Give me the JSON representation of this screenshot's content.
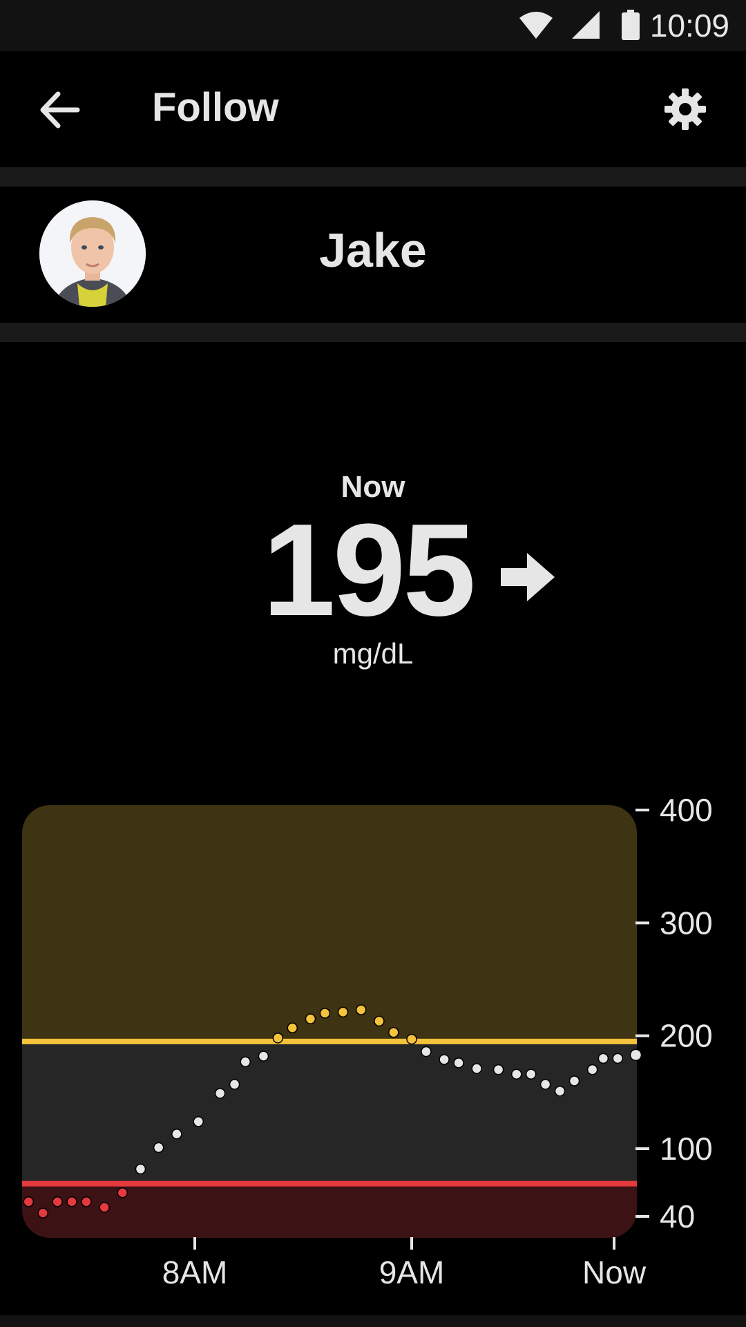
{
  "status_bar": {
    "time": "10:09",
    "icons": [
      "wifi-icon",
      "signal-icon",
      "battery-icon"
    ]
  },
  "app_bar": {
    "title": "Follow",
    "back_icon": "arrow-left-icon",
    "settings_icon": "gear-icon"
  },
  "profile": {
    "name": "Jake"
  },
  "reading": {
    "label": "Now",
    "value": "195",
    "unit": "mg/dL",
    "trend_icon": "arrow-right-icon"
  },
  "colors": {
    "background": "#000000",
    "high_zone": "#3e3312",
    "in_range_zone": "#262626",
    "low_zone": "#3c1214",
    "high_line": "#f5c23b",
    "low_line": "#e5393e",
    "point_normal": "#e6e6e6",
    "point_high": "#f5c23b",
    "point_low": "#e5393e"
  },
  "chart_data": {
    "type": "scatter",
    "y_ticks": [
      "400",
      "300",
      "200",
      "100",
      "40"
    ],
    "y_tick_values": [
      400,
      300,
      200,
      100,
      40
    ],
    "ylim": [
      30,
      405
    ],
    "x_ticks": [
      "8AM",
      "9AM",
      "Now"
    ],
    "x_tick_values": [
      0,
      60,
      116
    ],
    "xlim": [
      -48,
      122
    ],
    "high_threshold": 195,
    "low_threshold": 69,
    "points": [
      {
        "x": -46,
        "y": 53
      },
      {
        "x": -42,
        "y": 43
      },
      {
        "x": -38,
        "y": 53
      },
      {
        "x": -34,
        "y": 53
      },
      {
        "x": -30,
        "y": 53
      },
      {
        "x": -25,
        "y": 48
      },
      {
        "x": -20,
        "y": 61
      },
      {
        "x": -15,
        "y": 82
      },
      {
        "x": -10,
        "y": 101
      },
      {
        "x": -5,
        "y": 113
      },
      {
        "x": 1,
        "y": 124
      },
      {
        "x": 7,
        "y": 149
      },
      {
        "x": 11,
        "y": 157
      },
      {
        "x": 14,
        "y": 177
      },
      {
        "x": 19,
        "y": 182
      },
      {
        "x": 23,
        "y": 198
      },
      {
        "x": 27,
        "y": 207
      },
      {
        "x": 32,
        "y": 215
      },
      {
        "x": 36,
        "y": 220
      },
      {
        "x": 41,
        "y": 221
      },
      {
        "x": 46,
        "y": 223
      },
      {
        "x": 51,
        "y": 213
      },
      {
        "x": 55,
        "y": 203
      },
      {
        "x": 60,
        "y": 197
      },
      {
        "x": 64,
        "y": 186
      },
      {
        "x": 69,
        "y": 179
      },
      {
        "x": 73,
        "y": 176
      },
      {
        "x": 78,
        "y": 171
      },
      {
        "x": 84,
        "y": 170
      },
      {
        "x": 89,
        "y": 166
      },
      {
        "x": 93,
        "y": 166
      },
      {
        "x": 97,
        "y": 157
      },
      {
        "x": 101,
        "y": 151
      },
      {
        "x": 105,
        "y": 160
      },
      {
        "x": 110,
        "y": 170
      },
      {
        "x": 113,
        "y": 180
      },
      {
        "x": 117,
        "y": 180
      },
      {
        "x": 122,
        "y": 183
      }
    ]
  }
}
